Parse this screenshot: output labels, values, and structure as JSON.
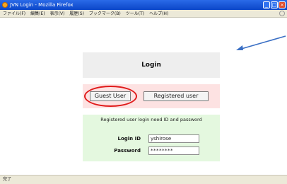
{
  "window": {
    "title": "JVN Login - Mozilla Firefox",
    "buttons": [
      "_",
      "□",
      "×"
    ]
  },
  "menu": {
    "items": [
      "ファイル(F)",
      "編集(E)",
      "表示(V)",
      "履歴(S)",
      "ブックマーク(B)",
      "ツール(T)",
      "ヘルプ(H)"
    ]
  },
  "login_panel": {
    "heading": "Login"
  },
  "buttons_panel": {
    "guest_label": "Guest User",
    "registered_label": "Registered user"
  },
  "form": {
    "description": "Registered user login need ID and password",
    "id_label": "Login ID",
    "id_value": "yshirose",
    "password_label": "Password",
    "password_value": "********"
  },
  "status": {
    "text": "完了"
  },
  "colors": {
    "titlebar": "#0b46c8",
    "highlight": "#e01b1b",
    "arrow": "#3a6fc4",
    "login_panel_bg": "#eeeeee",
    "buttons_panel_bg": "#fde2e2",
    "form_panel_bg": "#e4f8df"
  }
}
